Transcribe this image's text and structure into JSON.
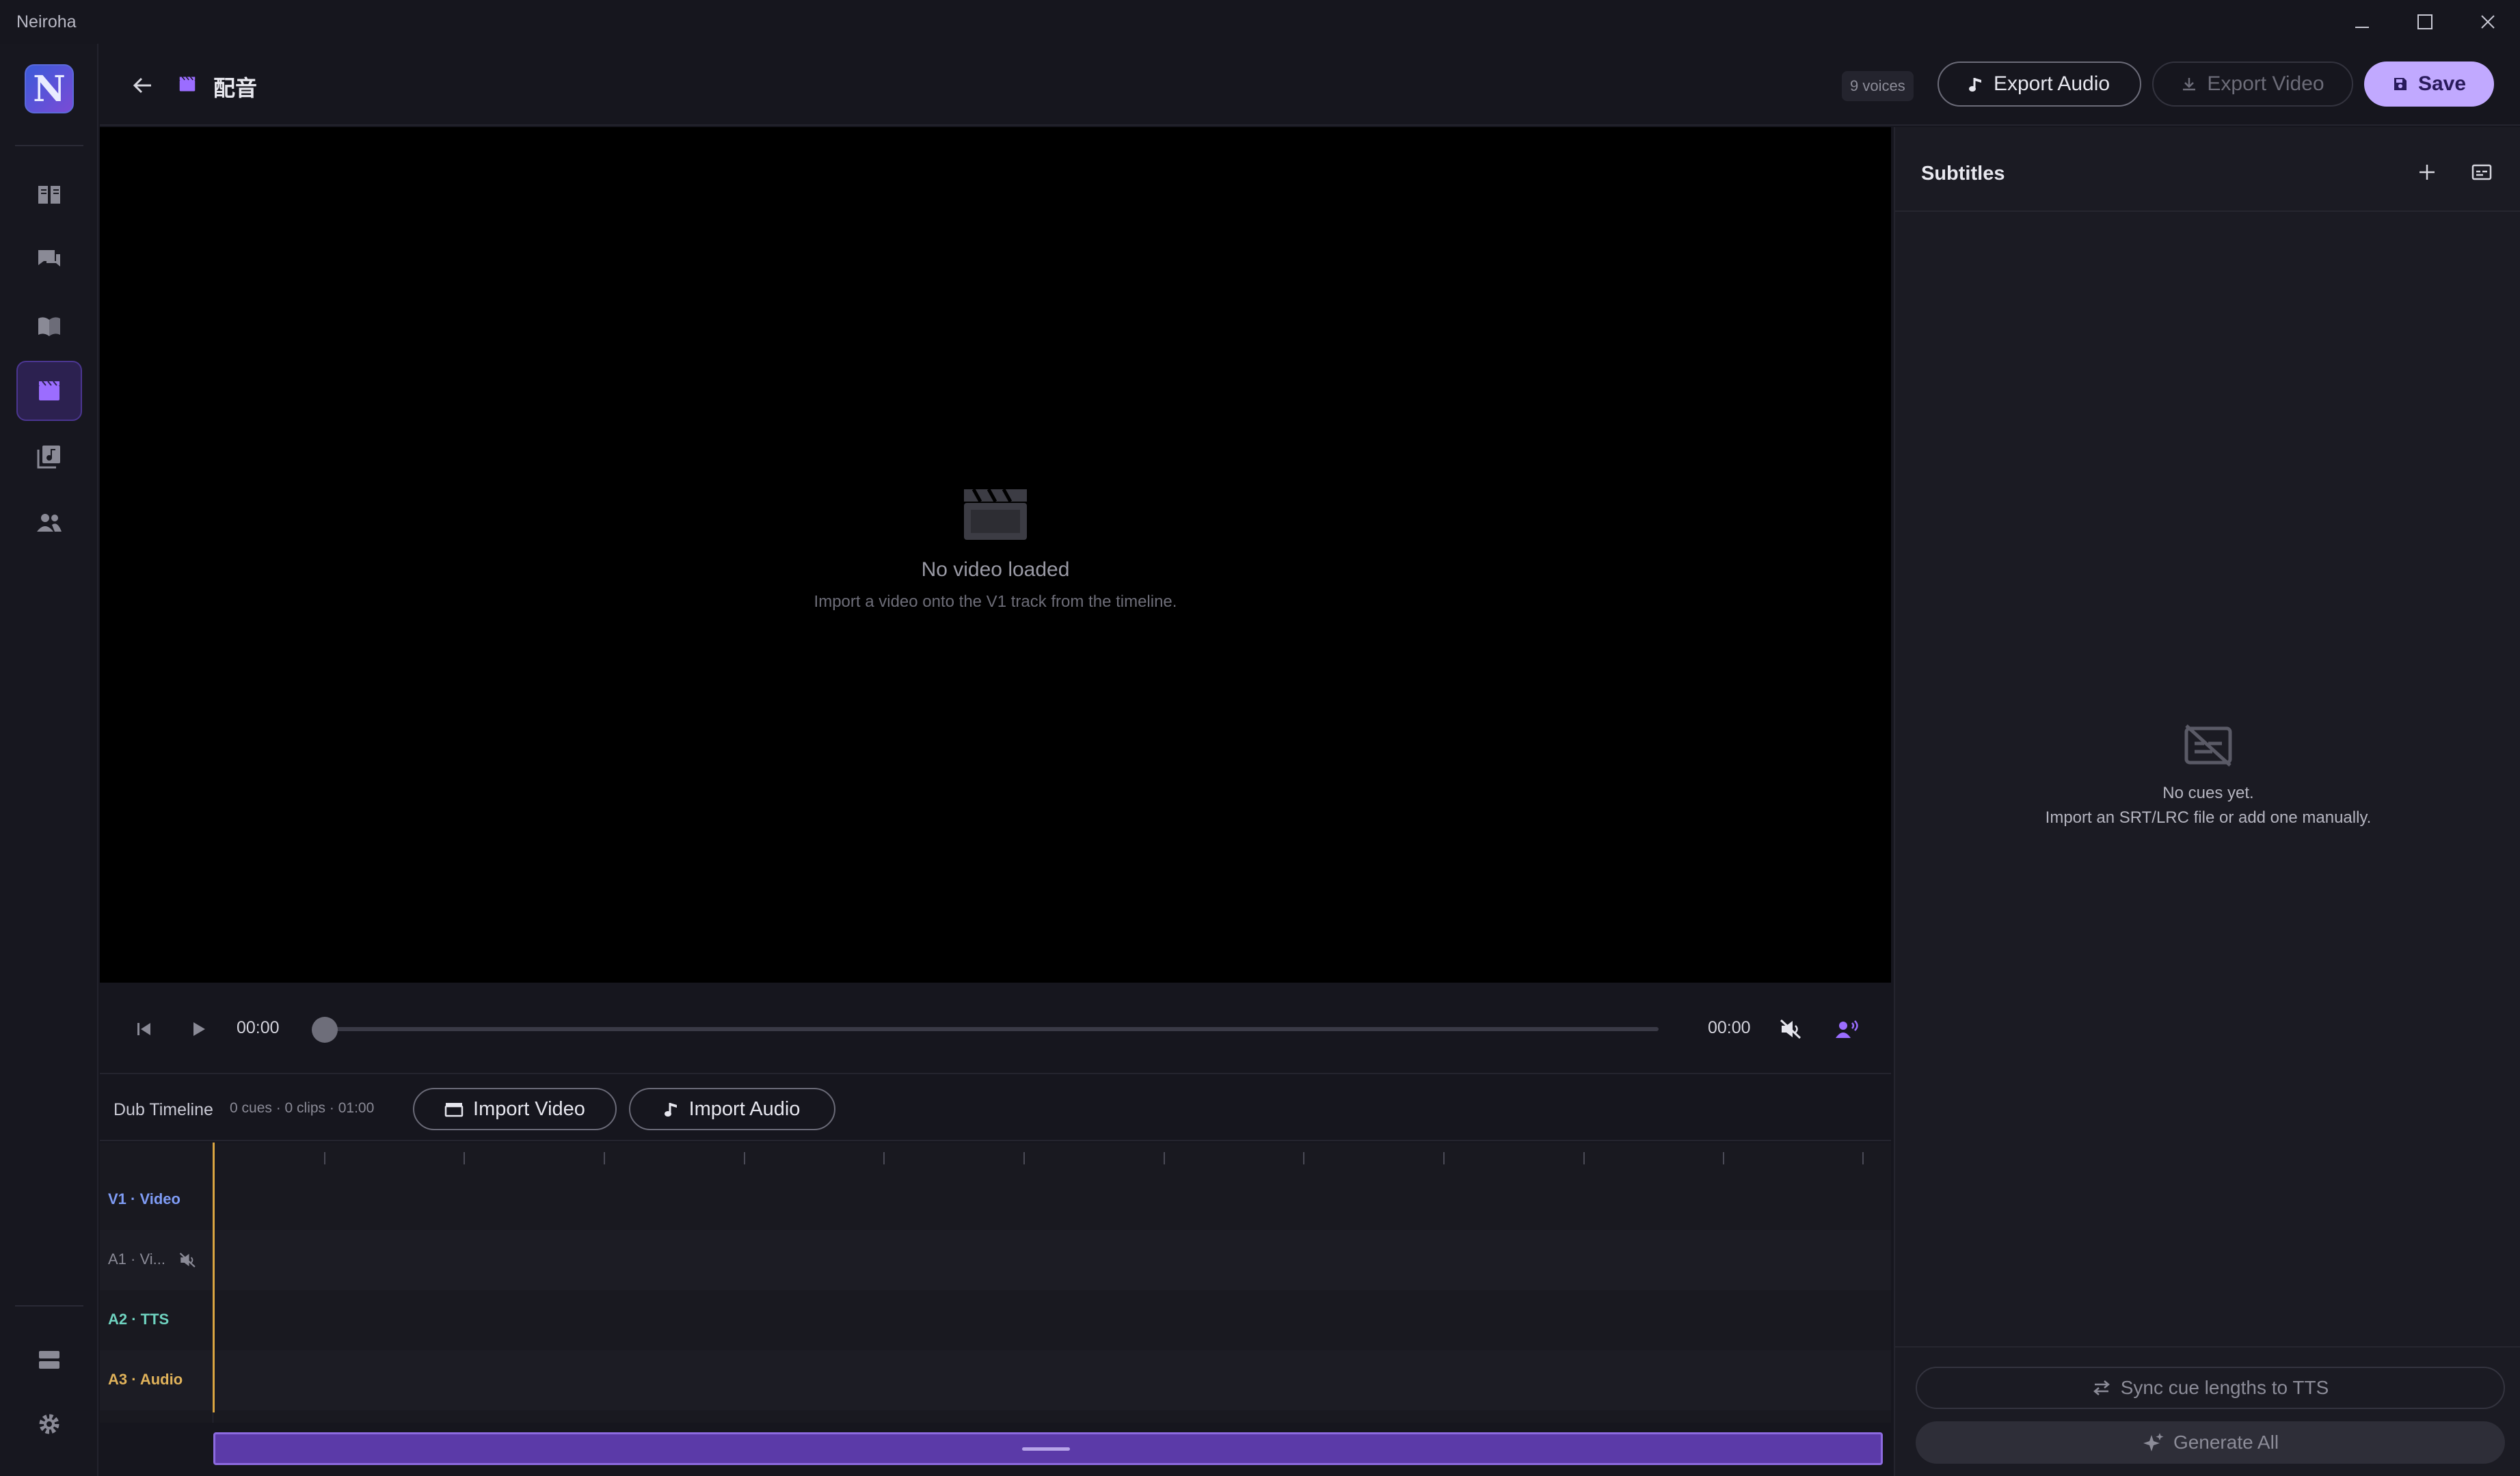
{
  "app": {
    "title": "Neiroha"
  },
  "window": {
    "minimize_icon": "minimize-icon",
    "maximize_icon": "maximize-icon",
    "close_icon": "close-icon"
  },
  "rail": {
    "logo_letter": "N",
    "items": [
      {
        "name": "library",
        "icon": "book-icon"
      },
      {
        "name": "chat",
        "icon": "chat-icon"
      },
      {
        "name": "stories",
        "icon": "open-book-icon"
      },
      {
        "name": "dubbing",
        "icon": "clapperboard-icon",
        "active": true
      },
      {
        "name": "audio-library",
        "icon": "music-library-icon"
      },
      {
        "name": "voices",
        "icon": "people-icon"
      }
    ],
    "bottom": [
      {
        "name": "storage",
        "icon": "storage-icon"
      },
      {
        "name": "settings",
        "icon": "gear-icon"
      }
    ]
  },
  "header": {
    "title": "配音",
    "voices_badge": "9 voices",
    "export_audio": "Export Audio",
    "export_video": "Export Video",
    "save": "Save"
  },
  "video": {
    "empty_title": "No video loaded",
    "empty_hint": "Import a video onto the V1 track from the timeline."
  },
  "player": {
    "current_time": "00:00",
    "total_time": "00:00",
    "progress": 0
  },
  "timeline": {
    "title": "Dub Timeline",
    "meta": "0 cues · 0 clips · 01:00",
    "import_video": "Import Video",
    "import_audio": "Import Audio",
    "tracks": [
      {
        "label": "V1 · Video",
        "color": "#7f9cf5"
      },
      {
        "label": "A1 · Vi...",
        "color": "#8a8a96",
        "muted": true
      },
      {
        "label": "A2 · TTS",
        "color": "#6fd3c0"
      },
      {
        "label": "A3 · Audio",
        "color": "#e0b25a"
      }
    ],
    "playhead_color": "#d9a441"
  },
  "subtitles": {
    "title": "Subtitles",
    "empty_title": "No cues yet.",
    "empty_hint": "Import an SRT/LRC file or add one manually.",
    "sync_button": "Sync cue lengths to TTS",
    "generate_button": "Generate All"
  },
  "colors": {
    "accent": "#c1a9ff",
    "accent_dark": "#5b3aa8"
  }
}
